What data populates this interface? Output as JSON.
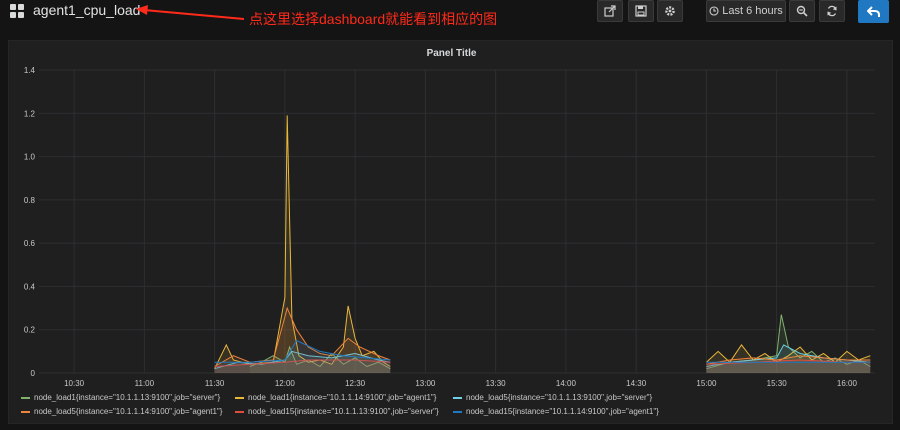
{
  "header": {
    "dashboard_title": "agent1_cpu_load",
    "annotation": "点这里选择dashboard就能看到相应的图",
    "time_range_label": "Last 6 hours",
    "icons": [
      "share-icon",
      "save-icon",
      "gear-icon",
      "clock-icon",
      "zoom-out-icon",
      "refresh-icon",
      "back-arrow-icon"
    ]
  },
  "panel": {
    "title": "Panel Title"
  },
  "colors": {
    "green": "#7eb26d",
    "yellow": "#eab839",
    "light_blue": "#6ed0e0",
    "orange": "#ef843c",
    "red": "#e24d42",
    "blue": "#1f78c1",
    "annotation": "#ff2a1a",
    "grid": "#2f2f30"
  },
  "chart_data": {
    "type": "line",
    "x_axis": {
      "range": [
        "10:15",
        "16:12"
      ],
      "ticks": [
        "10:30",
        "11:00",
        "11:30",
        "12:00",
        "12:30",
        "13:00",
        "13:30",
        "14:00",
        "14:30",
        "15:00",
        "15:30",
        "16:00"
      ]
    },
    "y_axis": {
      "range": [
        0,
        1.4
      ],
      "ticks": [
        "0",
        "0.2",
        "0.4",
        "0.6",
        "0.8",
        "1.0",
        "1.2",
        "1.4"
      ]
    },
    "grid": true,
    "legend_position": "bottom",
    "series": [
      {
        "name": "node_load1{instance=\"10.1.1.13:9100\",job=\"server\"}",
        "color": "#7eb26d",
        "points": [
          [
            "11:45",
            0.03
          ],
          [
            "11:50",
            0.05
          ],
          [
            "11:55",
            0.08
          ],
          [
            "12:00",
            0.05
          ],
          [
            "12:02",
            0.12
          ],
          [
            "12:05",
            0.04
          ],
          [
            "12:10",
            0.06
          ],
          [
            "12:15",
            0.03
          ],
          [
            "12:20",
            0.09
          ],
          [
            "12:25",
            0.04
          ],
          [
            "12:30",
            0.07
          ],
          [
            "12:35",
            0.03
          ],
          [
            "12:40",
            0.05
          ],
          [
            "12:45",
            0.02
          ],
          [
            "15:00",
            0.02
          ],
          [
            "15:10",
            0.05
          ],
          [
            "15:20",
            0.06
          ],
          [
            "15:30",
            0.08
          ],
          [
            "15:32",
            0.27
          ],
          [
            "15:35",
            0.12
          ],
          [
            "15:40",
            0.07
          ],
          [
            "15:45",
            0.1
          ],
          [
            "15:50",
            0.05
          ],
          [
            "15:55",
            0.07
          ],
          [
            "16:00",
            0.04
          ],
          [
            "16:05",
            0.06
          ],
          [
            "16:10",
            0.03
          ]
        ]
      },
      {
        "name": "node_load1{instance=\"10.1.1.14:9100\",job=\"agent1\"}",
        "color": "#eab839",
        "points": [
          [
            "11:30",
            0.02
          ],
          [
            "11:35",
            0.13
          ],
          [
            "11:38",
            0.06
          ],
          [
            "11:45",
            0.04
          ],
          [
            "11:55",
            0.05
          ],
          [
            "12:00",
            0.35
          ],
          [
            "12:01",
            1.19
          ],
          [
            "12:03",
            0.25
          ],
          [
            "12:06",
            0.08
          ],
          [
            "12:10",
            0.05
          ],
          [
            "12:15",
            0.06
          ],
          [
            "12:20",
            0.04
          ],
          [
            "12:25",
            0.12
          ],
          [
            "12:27",
            0.31
          ],
          [
            "12:30",
            0.16
          ],
          [
            "12:33",
            0.08
          ],
          [
            "12:38",
            0.1
          ],
          [
            "12:42",
            0.05
          ],
          [
            "12:45",
            0.03
          ],
          [
            "15:00",
            0.05
          ],
          [
            "15:05",
            0.1
          ],
          [
            "15:10",
            0.05
          ],
          [
            "15:15",
            0.13
          ],
          [
            "15:20",
            0.06
          ],
          [
            "15:25",
            0.09
          ],
          [
            "15:30",
            0.05
          ],
          [
            "15:35",
            0.08
          ],
          [
            "15:40",
            0.12
          ],
          [
            "15:45",
            0.06
          ],
          [
            "15:50",
            0.09
          ],
          [
            "15:55",
            0.05
          ],
          [
            "16:00",
            0.1
          ],
          [
            "16:05",
            0.06
          ],
          [
            "16:10",
            0.08
          ]
        ]
      },
      {
        "name": "node_load5{instance=\"10.1.1.13:9100\",job=\"server\"}",
        "color": "#6ed0e0",
        "points": [
          [
            "11:30",
            0.02
          ],
          [
            "11:40",
            0.05
          ],
          [
            "11:50",
            0.04
          ],
          [
            "12:00",
            0.06
          ],
          [
            "12:03",
            0.1
          ],
          [
            "12:10",
            0.08
          ],
          [
            "12:20",
            0.07
          ],
          [
            "12:30",
            0.09
          ],
          [
            "12:40",
            0.06
          ],
          [
            "12:45",
            0.05
          ],
          [
            "15:00",
            0.03
          ],
          [
            "15:10",
            0.05
          ],
          [
            "15:20",
            0.06
          ],
          [
            "15:30",
            0.07
          ],
          [
            "15:33",
            0.13
          ],
          [
            "15:40",
            0.09
          ],
          [
            "15:50",
            0.07
          ],
          [
            "16:00",
            0.06
          ],
          [
            "16:10",
            0.05
          ]
        ]
      },
      {
        "name": "node_load5{instance=\"10.1.1.14:9100\",job=\"agent1\"}",
        "color": "#ef843c",
        "points": [
          [
            "11:30",
            0.03
          ],
          [
            "11:38",
            0.08
          ],
          [
            "11:45",
            0.05
          ],
          [
            "11:55",
            0.06
          ],
          [
            "12:01",
            0.3
          ],
          [
            "12:05",
            0.2
          ],
          [
            "12:10",
            0.12
          ],
          [
            "12:15",
            0.09
          ],
          [
            "12:20",
            0.08
          ],
          [
            "12:27",
            0.16
          ],
          [
            "12:32",
            0.12
          ],
          [
            "12:40",
            0.08
          ],
          [
            "12:45",
            0.06
          ],
          [
            "15:00",
            0.04
          ],
          [
            "15:10",
            0.06
          ],
          [
            "15:20",
            0.07
          ],
          [
            "15:30",
            0.06
          ],
          [
            "15:40",
            0.08
          ],
          [
            "15:50",
            0.07
          ],
          [
            "16:00",
            0.06
          ],
          [
            "16:10",
            0.06
          ]
        ]
      },
      {
        "name": "node_load15{instance=\"10.1.1.13:9100\",job=\"server\"}",
        "color": "#e24d42",
        "points": [
          [
            "11:30",
            0.03
          ],
          [
            "11:45",
            0.04
          ],
          [
            "12:00",
            0.05
          ],
          [
            "12:10",
            0.06
          ],
          [
            "12:20",
            0.06
          ],
          [
            "12:30",
            0.06
          ],
          [
            "12:45",
            0.05
          ],
          [
            "15:00",
            0.04
          ],
          [
            "15:20",
            0.05
          ],
          [
            "15:40",
            0.06
          ],
          [
            "16:00",
            0.05
          ],
          [
            "16:10",
            0.05
          ]
        ]
      },
      {
        "name": "node_load15{instance=\"10.1.1.14:9100\",job=\"agent1\"}",
        "color": "#1f78c1",
        "points": [
          [
            "11:30",
            0.05
          ],
          [
            "11:45",
            0.05
          ],
          [
            "12:00",
            0.06
          ],
          [
            "12:05",
            0.15
          ],
          [
            "12:15",
            0.1
          ],
          [
            "12:25",
            0.08
          ],
          [
            "12:35",
            0.07
          ],
          [
            "12:45",
            0.06
          ],
          [
            "15:00",
            0.05
          ],
          [
            "15:30",
            0.05
          ],
          [
            "16:00",
            0.05
          ],
          [
            "16:10",
            0.05
          ]
        ]
      }
    ]
  }
}
